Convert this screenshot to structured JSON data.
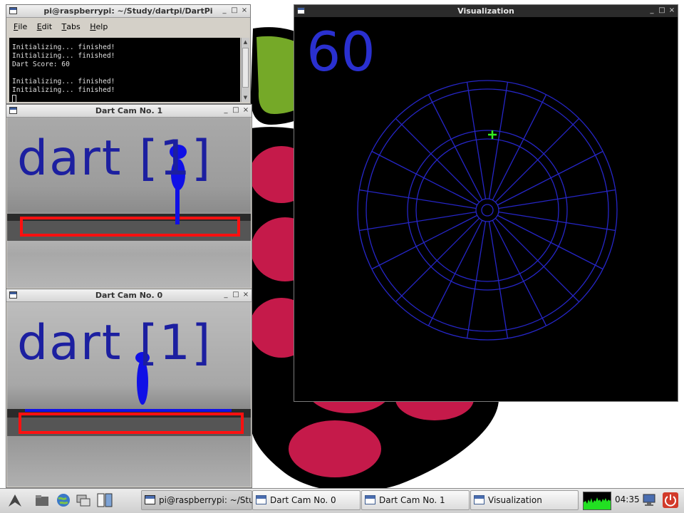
{
  "colors": {
    "desktop_bg": "#ffffff",
    "raspberry_red": "#c51a4a",
    "raspberry_leaf": "#75a928",
    "highlight_red": "#ff1010",
    "blob_blue": "#1010e6",
    "board_blue": "#2626c8",
    "hit_marker": "#33ee22"
  },
  "terminal": {
    "title": "pi@raspberrypi: ~/Study/dartpi/DartPi",
    "menu": [
      {
        "label": "File",
        "mnemonic": "F"
      },
      {
        "label": "Edit",
        "mnemonic": "E"
      },
      {
        "label": "Tabs",
        "mnemonic": "T"
      },
      {
        "label": "Help",
        "mnemonic": "H"
      }
    ],
    "lines": [
      "Initializing... finished!",
      "Initializing... finished!",
      "Dart Score: 60",
      "",
      "Initializing... finished!",
      "Initializing... finished!"
    ]
  },
  "cam1": {
    "title": "Dart Cam No. 1",
    "overlay": "dart [1]"
  },
  "cam0": {
    "title": "Dart Cam No. 0",
    "overlay": "dart [1]"
  },
  "visualization": {
    "title": "Visualization",
    "score": "60",
    "segments": 20
  },
  "window_buttons": {
    "minimize": "_",
    "maximize": "□",
    "close": "×"
  },
  "taskbar": {
    "tasks": [
      {
        "label": "pi@raspberrypi: ~/Stu...",
        "active": true
      },
      {
        "label": "Dart Cam No. 0",
        "active": false
      },
      {
        "label": "Dart Cam No. 1",
        "active": false
      },
      {
        "label": "Visualization",
        "active": false
      }
    ],
    "clock": "04:35"
  }
}
